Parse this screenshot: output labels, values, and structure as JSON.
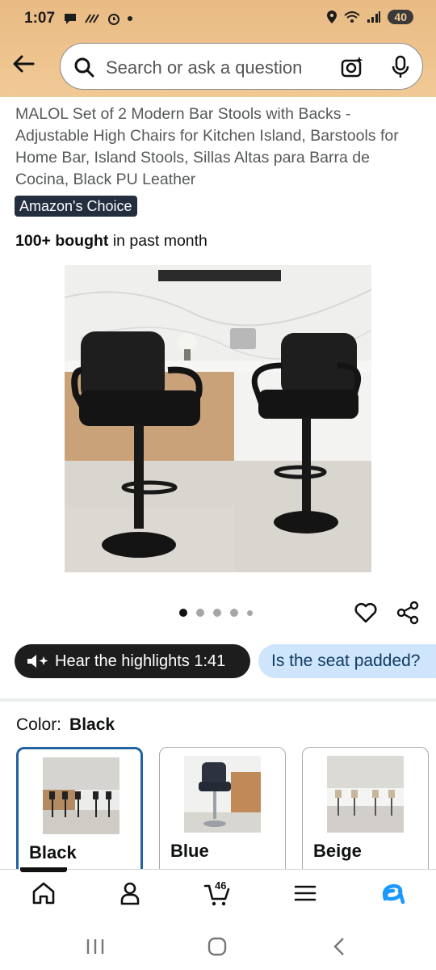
{
  "status_bar": {
    "time": "1:07",
    "battery": "40"
  },
  "search": {
    "placeholder": "Search or ask a question"
  },
  "product": {
    "title": "MALOL Set of 2 Modern Bar Stools with Backs - Adjustable High Chairs for Kitchen Island, Barstools for Home Bar, Island Stools, Sillas Altas para Barra de Cocina, Black PU Leather",
    "badge": "Amazon's Choice",
    "bought_bold": "100+ bought",
    "bought_rest": " in past month",
    "image_count": 5,
    "image_index": 1
  },
  "chips": {
    "highlights": "Hear the highlights 1:41",
    "question": "Is the seat padded?"
  },
  "color": {
    "label": "Color:",
    "selected": "Black",
    "options": [
      {
        "label": "Black"
      },
      {
        "label": "Blue"
      },
      {
        "label": "Beige"
      }
    ]
  },
  "bottom_nav": {
    "cart_count": "46",
    "items": [
      "home-icon",
      "account-icon",
      "cart-icon",
      "menu-icon",
      "rufus-icon"
    ]
  },
  "colors": {
    "header": "#f1c995",
    "accent": "#2162a1",
    "chip_light": "#cfe5fb"
  }
}
